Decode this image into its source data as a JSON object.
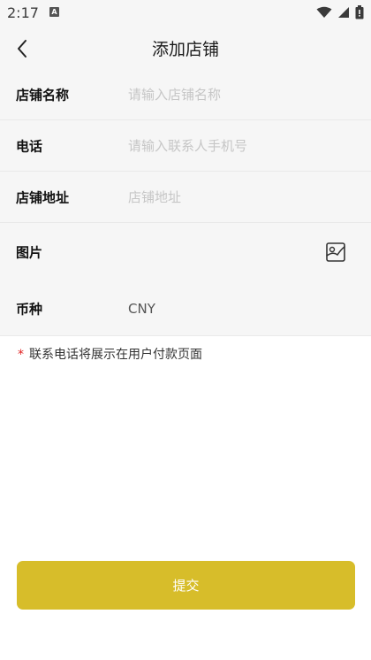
{
  "status_bar": {
    "time": "2:17",
    "notification_glyph": "A"
  },
  "header": {
    "title": "添加店铺"
  },
  "form": {
    "shop_name": {
      "label": "店铺名称",
      "placeholder": "请输入店铺名称"
    },
    "phone": {
      "label": "电话",
      "placeholder": "请输入联系人手机号"
    },
    "address": {
      "label": "店铺地址",
      "placeholder": "店铺地址"
    },
    "image": {
      "label": "图片"
    },
    "currency": {
      "label": "币种",
      "value": "CNY"
    }
  },
  "note": {
    "star": "*",
    "text": "联系电话将展示在用户付款页面"
  },
  "submit": {
    "label": "提交"
  },
  "colors": {
    "accent": "#d7bd2a",
    "required_star": "#e02020",
    "form_background": "#f6f6f6"
  },
  "icons": {
    "back": "chevron-left-icon",
    "image_picker": "image-icon",
    "wifi": "wifi-icon",
    "signal": "signal-icon",
    "battery": "battery-icon"
  }
}
